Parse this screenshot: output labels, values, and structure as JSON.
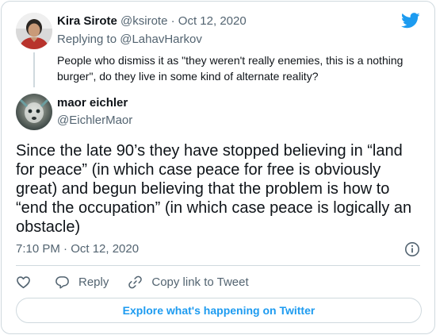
{
  "icons": {
    "brand": "twitter-bird-icon",
    "info": "info-icon",
    "like": "heart-icon",
    "reply": "reply-bubble-icon",
    "copy_link": "link-icon"
  },
  "colors": {
    "brand": "#1d9bf0",
    "muted": "#536471",
    "text": "#0f1419",
    "border": "#cfd9de"
  },
  "reply_tweet": {
    "author_name": "Kira Sirote",
    "author_handle": "@ksirote",
    "separator": "·",
    "date": "Oct 12, 2020",
    "replying_prefix": "Replying to",
    "replying_handle": "@LahavHarkov",
    "text": "People who dismiss it as \"they weren't really enemies, this is a nothing burger\", do they live in some kind of alternate reality?"
  },
  "main_tweet": {
    "author_name": "maor eichler",
    "author_handle": "@EichlerMaor",
    "text": "Since the late 90’s they have stopped believing in “land for peace” (in which case peace for free is obviously great) and begun believing that the problem is how to “end the occupation” (in which case peace is logically an obstacle)",
    "timestamp": "7:10 PM · Oct 12, 2020"
  },
  "actions": {
    "reply_label": "Reply",
    "copy_link_label": "Copy link to Tweet"
  },
  "explore_label": "Explore what's happening on Twitter"
}
